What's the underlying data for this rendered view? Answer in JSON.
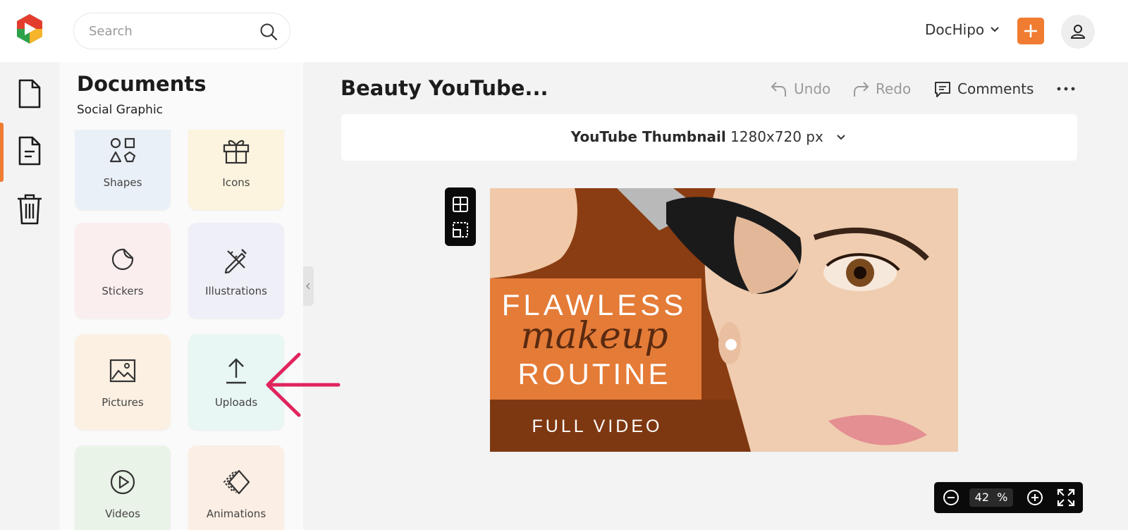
{
  "search": {
    "placeholder": "Search"
  },
  "header": {
    "account_name": "DocHipo"
  },
  "panel": {
    "title": "Documents",
    "subtitle": "Social Graphic",
    "tiles": [
      {
        "label": "Shapes",
        "bg": "#eaf0f7",
        "icon": "shapes-icon"
      },
      {
        "label": "Icons",
        "bg": "#fdf4df",
        "icon": "gift-icon"
      },
      {
        "label": "Stickers",
        "bg": "#fbeeee",
        "icon": "sticker-icon"
      },
      {
        "label": "Illustrations",
        "bg": "#efeff8",
        "icon": "pen-ruler-icon"
      },
      {
        "label": "Pictures",
        "bg": "#fbf0e2",
        "icon": "image-icon"
      },
      {
        "label": "Uploads",
        "bg": "#e8f6f4",
        "icon": "upload-icon"
      },
      {
        "label": "Videos",
        "bg": "#eaf3e8",
        "icon": "play-icon"
      },
      {
        "label": "Animations",
        "bg": "#fbeee4",
        "icon": "diamond-icon"
      }
    ]
  },
  "editor": {
    "doc_title": "Beauty YouTube...",
    "undo_label": "Undo",
    "redo_label": "Redo",
    "comments_label": "Comments",
    "format_name": "YouTube Thumbnail",
    "format_size": "1280x720 px"
  },
  "design": {
    "line1": "FLAWLESS",
    "line2": "makeup",
    "line3": "ROUTINE",
    "line4": "FULL VIDEO"
  },
  "zoom": {
    "value": "42",
    "unit": "%"
  },
  "colors": {
    "accent": "#f07c32",
    "annotation_arrow": "#e0245e"
  }
}
